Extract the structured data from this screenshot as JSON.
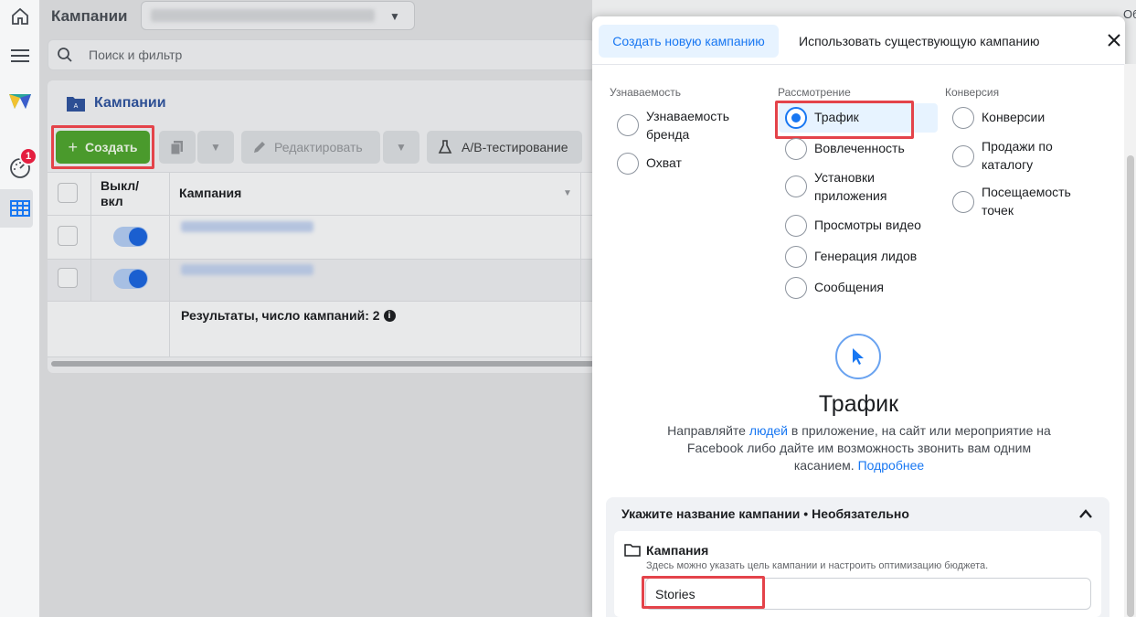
{
  "header": {
    "title": "Кампании",
    "account_selector_value": "",
    "corner_text": "Об"
  },
  "rail": {
    "notification_count": "1",
    "icons": [
      "home-icon",
      "menu-icon",
      "app-logo-icon",
      "dashboard-icon",
      "table-icon"
    ]
  },
  "search": {
    "placeholder": "Поиск и фильтр"
  },
  "campaigns_panel": {
    "title": "Кампании",
    "toolbar": {
      "create_label": "Создать",
      "edit_label": "Редактировать",
      "ab_test_label": "A/B-тестирование"
    },
    "table": {
      "columns": [
        "Выкл/ вкл",
        "Кампания"
      ],
      "rows": [
        {
          "toggle_on": true
        },
        {
          "toggle_on": true
        }
      ],
      "summary": "Результаты, число кампаний: 2"
    }
  },
  "dialog": {
    "tabs": [
      "Создать новую кампанию",
      "Использовать существующую кампанию"
    ],
    "active_tab": 0,
    "categories": [
      {
        "name": "Узнаваемость",
        "options": [
          "Узнаваемость бренда",
          "Охват"
        ]
      },
      {
        "name": "Рассмотрение",
        "options": [
          "Трафик",
          "Вовлеченность",
          "Установки приложения",
          "Просмотры видео",
          "Генерация лидов",
          "Сообщения"
        ]
      },
      {
        "name": "Конверсия",
        "options": [
          "Конверсии",
          "Продажи по каталогу",
          "Посещаемость точек"
        ]
      }
    ],
    "selected_objective": "Трафик",
    "objective_title": "Трафик",
    "objective_description": {
      "part1": "Направляйте ",
      "link1": "людей",
      "part2": " в приложение, на сайт или мероприятие на Facebook либо дайте им возможность звонить вам одним касанием. ",
      "link2": "Подробнее"
    },
    "name_section": {
      "header": "Укажите название кампании • Необязательно",
      "label": "Кампания",
      "help": "Здесь можно указать цель кампании и настроить оптимизацию бюджета.",
      "input_value": "Stories"
    }
  },
  "colors": {
    "accent": "#1877f2",
    "create_green": "#4a9a2c",
    "highlight_red": "#e4434a"
  }
}
